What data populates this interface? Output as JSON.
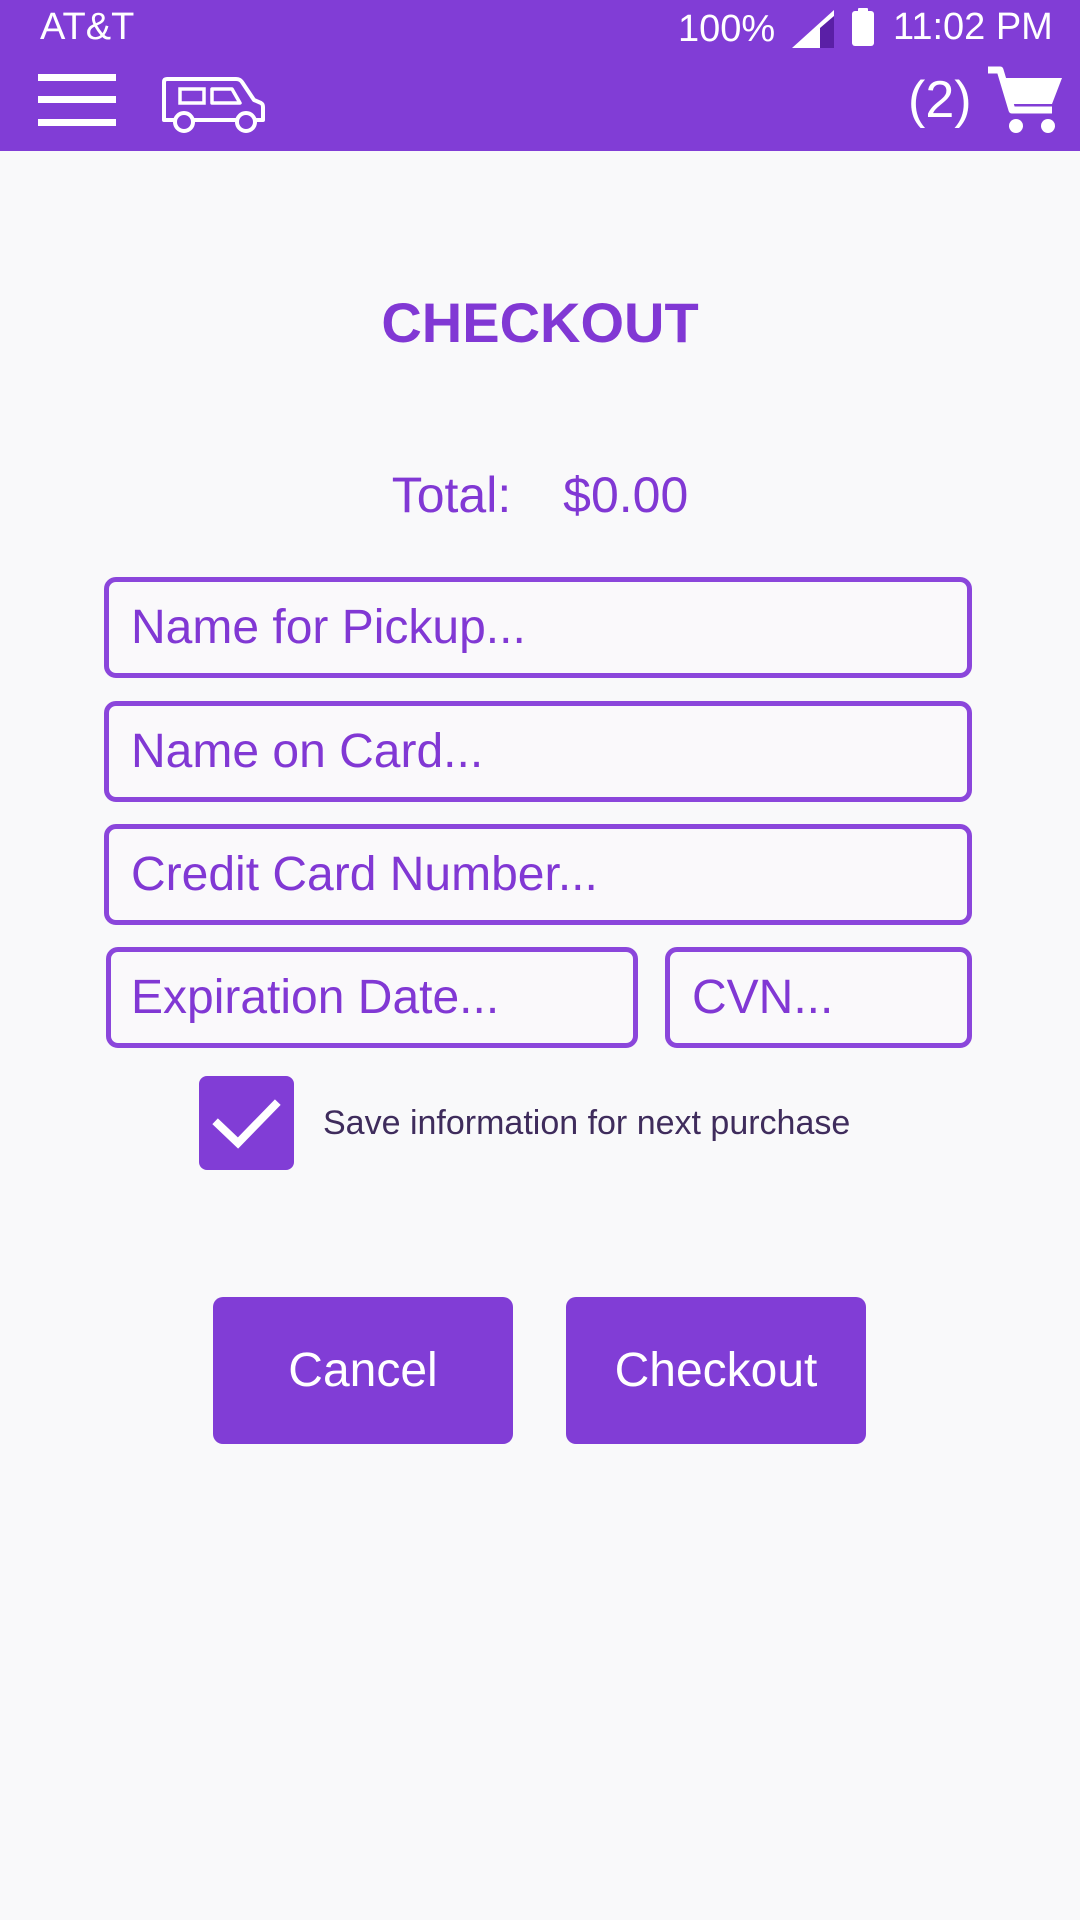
{
  "status_bar": {
    "carrier": "AT&T",
    "battery": "100%",
    "time": "11:02 PM"
  },
  "app_bar": {
    "menu_icon": "hamburger-menu-icon",
    "logo_icon": "food-truck-icon",
    "cart_count": "(2)",
    "cart_icon": "shopping-cart-icon"
  },
  "checkout": {
    "title": "CHECKOUT",
    "total_label": "Total:",
    "total_value": "$0.00",
    "fields": {
      "pickup_name": "Name for Pickup...",
      "card_name": "Name on Card...",
      "card_number": "Credit Card Number...",
      "expiration": "Expiration Date...",
      "cvn": "CVN..."
    },
    "save_info_checked": true,
    "save_info_label": "Save information for next purchase",
    "cancel_label": "Cancel",
    "checkout_label": "Checkout"
  },
  "colors": {
    "primary": "#813dd6",
    "text_dark": "#3f2c5c",
    "background": "#f9f9fa"
  }
}
